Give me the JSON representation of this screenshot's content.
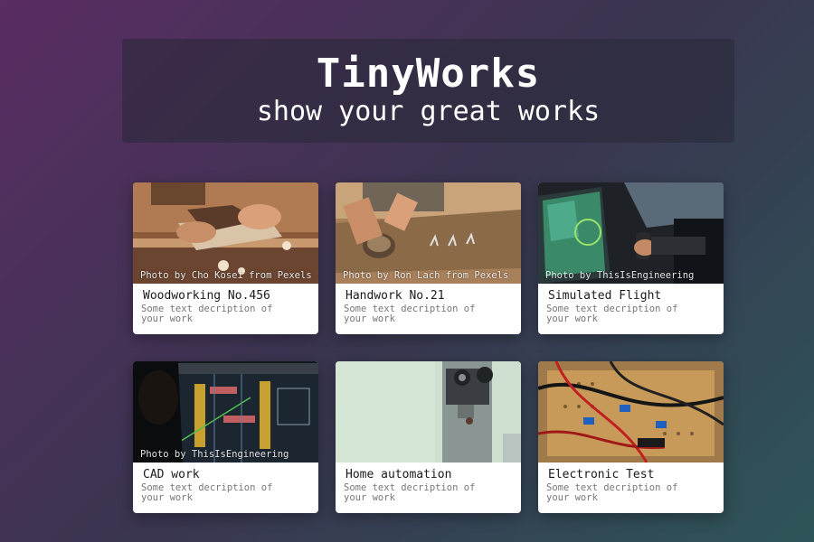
{
  "header": {
    "title": "TinyWorks",
    "subtitle": "show your great works"
  },
  "cards": [
    {
      "title": "Woodworking No.456",
      "description": "Some text decription of your work",
      "credit": "Photo by Cho Kosei from Pexels",
      "image": "woodworking-hands-plane-photo"
    },
    {
      "title": "Handwork No.21",
      "description": "Some text decription of your work",
      "credit": "Photo by Ron Lach from Pexels",
      "image": "handwork-wood-bowl-photo"
    },
    {
      "title": "Simulated Flight",
      "description": "Some text decription of your work",
      "credit": "Photo by ThisIsEngineering",
      "image": "flight-simulator-screen-photo"
    },
    {
      "title": "CAD work",
      "description": "Some text decription of your work",
      "credit": "Photo by ThisIsEngineering",
      "image": "cad-screen-photo"
    },
    {
      "title": "Home automation",
      "description": "Some text decription of your work",
      "credit": "",
      "image": "wall-switch-device-photo"
    },
    {
      "title": "Electronic Test",
      "description": "Some text decription of your work",
      "credit": "",
      "image": "circuit-board-wires-photo"
    }
  ],
  "colors": {
    "background_start": "#5a2d63",
    "background_end": "#2d5558",
    "header_panel": "#2b2a3a",
    "card": "#ffffff"
  }
}
